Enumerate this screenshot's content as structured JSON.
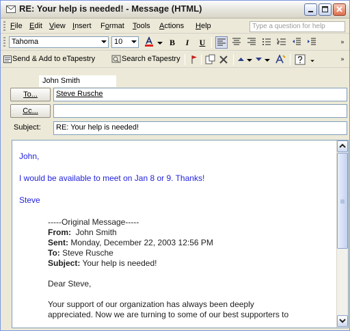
{
  "window": {
    "title": "RE: Your help is needed! - Message (HTML)"
  },
  "menubar": {
    "items": [
      {
        "label": "File",
        "ul": "F",
        "rest": "ile"
      },
      {
        "label": "Edit",
        "ul": "E",
        "rest": "dit"
      },
      {
        "label": "View",
        "ul": "V",
        "rest": "iew"
      },
      {
        "label": "Insert",
        "ul": "I",
        "rest": "nsert"
      },
      {
        "label": "Format",
        "ul": "o",
        "pre": "F",
        "rest": "rmat"
      },
      {
        "label": "Tools",
        "ul": "T",
        "rest": "ools"
      },
      {
        "label": "Actions",
        "ul": "A",
        "rest": "ctions"
      },
      {
        "label": "Help",
        "ul": "H",
        "rest": "elp"
      }
    ],
    "help_placeholder": "Type a question for help"
  },
  "format_toolbar": {
    "font": "Tahoma",
    "size": "10",
    "bold": "B",
    "italic": "I",
    "underline": "U"
  },
  "standard_toolbar": {
    "send_add": "Send & Add to eTapestry",
    "search": "Search eTapestry"
  },
  "header": {
    "tooltip": "John Smith",
    "to_label": "To...",
    "to_value": "Steve Rusche",
    "cc_label": "Cc...",
    "cc_value": "",
    "subject_label": "Subject:",
    "subject_value": "RE: Your help is needed!"
  },
  "message": {
    "reply_lines": [
      "John,",
      "I would be available to meet on Jan 8 or 9.  Thanks!",
      "Steve"
    ],
    "original_header": "-----Original Message-----",
    "from_label": "From:",
    "from_value": "John Smith",
    "sent_label": "Sent:",
    "sent_value": "Monday, December 22, 2003 12:56 PM",
    "to_label": "To:",
    "to_value": "Steve Rusche",
    "subject_label": "Subject:",
    "subject_value": "Your help is needed!",
    "greeting": "Dear Steve,",
    "paragraph_line1": "Your support of our organization has always been deeply",
    "paragraph_line2": "appreciated.  Now we are turning to some of our best supporters to"
  },
  "colors": {
    "reply_text": "#2222dd",
    "title_bar": "#e9e8e1"
  }
}
